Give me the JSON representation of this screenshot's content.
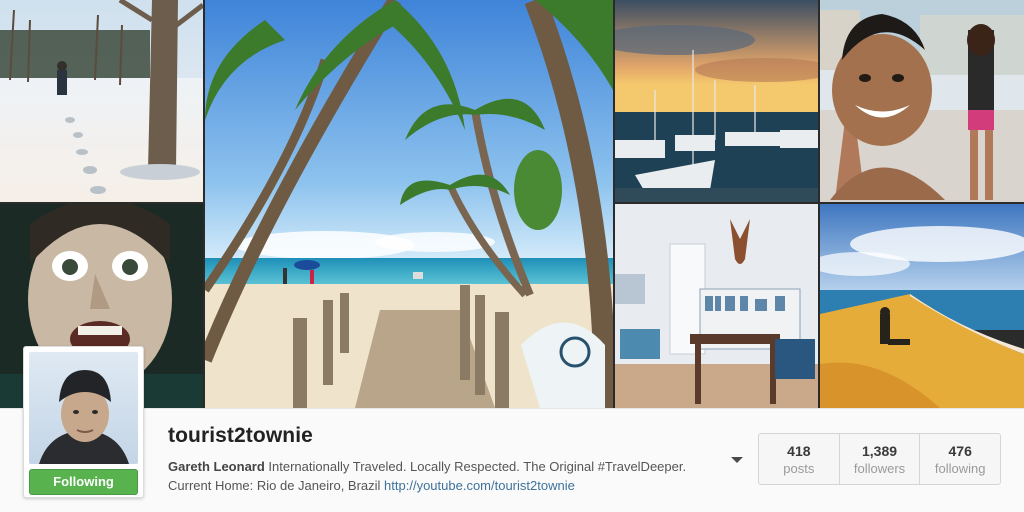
{
  "profile": {
    "username": "tourist2townie",
    "full_name": "Gareth Leonard",
    "bio": "Internationally Traveled. Locally Respected. The Original #TravelDeeper.",
    "location_line": "Current Home: Rio de Janeiro, Brazil",
    "website": "http://youtube.com/tourist2townie",
    "follow_button_label": "Following",
    "follow_button_color": "#58b34f",
    "link_color": "#3f729b"
  },
  "stats": [
    {
      "value": "418",
      "label": "posts"
    },
    {
      "value": "1,389",
      "label": "followers"
    },
    {
      "value": "476",
      "label": "following"
    }
  ],
  "icons": {
    "more_options": "chevron-down-icon"
  },
  "photos": [
    {
      "subject": "snow-walk"
    },
    {
      "subject": "shocked-face"
    },
    {
      "subject": "palm-beach"
    },
    {
      "subject": "marina-sunset"
    },
    {
      "subject": "smiling-kid"
    },
    {
      "subject": "vintage-room"
    },
    {
      "subject": "sand-dune"
    }
  ]
}
